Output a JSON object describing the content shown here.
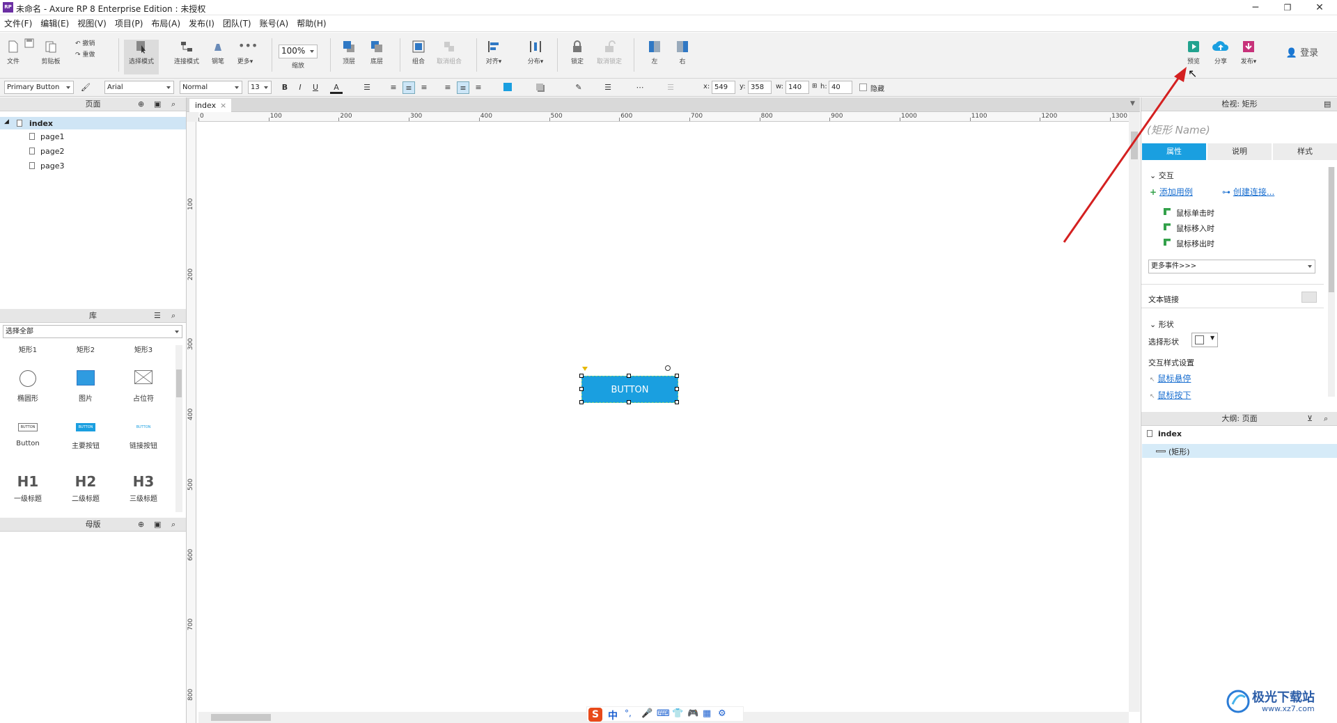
{
  "window": {
    "title": "未命名 - Axure RP 8 Enterprise Edition : 未授权",
    "logo": "RP"
  },
  "menu": [
    "文件(F)",
    "编辑(E)",
    "视图(V)",
    "项目(P)",
    "布局(A)",
    "发布(I)",
    "团队(T)",
    "账号(A)",
    "帮助(H)"
  ],
  "toolbar": {
    "file": "文件",
    "clipboard": "剪贴板",
    "undo": "撤销",
    "redo": "重做",
    "select_mode": "选择模式",
    "connect_mode": "连接模式",
    "pen": "钢笔",
    "more": "更多▾",
    "zoom_value": "100%",
    "zoom_label": "缩放",
    "top": "顶层",
    "bottom": "底层",
    "group": "组合",
    "ungroup": "取消组合",
    "align": "对齐▾",
    "distribute": "分布▾",
    "lock": "锁定",
    "unlock": "取消锁定",
    "left": "左",
    "right": "右",
    "preview": "预览",
    "share": "分享",
    "publish": "发布▾",
    "login": "登录"
  },
  "format": {
    "style": "Primary Button",
    "font": "Arial",
    "weight": "Normal",
    "size": "13",
    "bold": "B",
    "italic": "I",
    "underline": "U",
    "font_color": "A",
    "x_label": "x:",
    "x": "549",
    "y_label": "y:",
    "y": "358",
    "w_label": "w:",
    "w": "140",
    "h_label": "h:",
    "h": "40",
    "hidden": "隐藏"
  },
  "pages_panel": {
    "title": "页面",
    "root": "index",
    "children": [
      "page1",
      "page2",
      "page3"
    ]
  },
  "library_panel": {
    "title": "库",
    "select": "选择全部",
    "row0": [
      "矩形1",
      "矩形2",
      "矩形3"
    ],
    "items": [
      {
        "label": "椭圆形",
        "icon": "ellipse-icon"
      },
      {
        "label": "图片",
        "icon": "image-icon"
      },
      {
        "label": "占位符",
        "icon": "placeholder-icon"
      },
      {
        "label": "Button",
        "icon": "button-widget-icon",
        "thumb": "BUTTON"
      },
      {
        "label": "主要按钮",
        "icon": "primary-button-icon",
        "thumb": "BUTTON"
      },
      {
        "label": "链接按钮",
        "icon": "link-button-icon",
        "thumb": "BUTTON"
      },
      {
        "label": "一级标题",
        "icon": "h1-icon",
        "thumb": "H1"
      },
      {
        "label": "二级标题",
        "icon": "h2-icon",
        "thumb": "H2"
      },
      {
        "label": "三级标题",
        "icon": "h3-icon",
        "thumb": "H3"
      }
    ]
  },
  "masters_panel": {
    "title": "母版"
  },
  "canvas": {
    "tab": "index",
    "ruler_h": [
      "0",
      "100",
      "200",
      "300",
      "400",
      "500",
      "600",
      "700",
      "800",
      "900",
      "1000",
      "1100",
      "1200",
      "1300"
    ],
    "ruler_v": [
      "100",
      "200",
      "300",
      "400",
      "500",
      "600",
      "700",
      "800"
    ],
    "button_text": "BUTTON",
    "button_color": "#1a9fe0"
  },
  "inspector": {
    "title": "检视: 矩形",
    "name_placeholder": "(矩形 Name)",
    "tabs": [
      "属性",
      "说明",
      "样式"
    ],
    "interaction": "交互",
    "add_case": "添加用例",
    "create_link": "创建连接...",
    "events": [
      "鼠标单击时",
      "鼠标移入时",
      "鼠标移出时"
    ],
    "more_events": "更多事件>>>",
    "text_link": "文本链接",
    "shape": "形状",
    "select_shape": "选择形状",
    "interaction_style": "交互样式设置",
    "hover": "鼠标悬停",
    "mousedown": "鼠标按下"
  },
  "outline": {
    "title": "大纲: 页面",
    "root": "index",
    "child": "(矩形)"
  },
  "ime_bar": [
    "S",
    "中",
    "°,",
    "mic",
    "kbd",
    "shirt",
    "game",
    "grid",
    "gear"
  ],
  "watermark": {
    "text": "极光下载站",
    "url": "www.xz7.com"
  },
  "accent": "#1a9fe0",
  "arrow_color": "#d42020"
}
